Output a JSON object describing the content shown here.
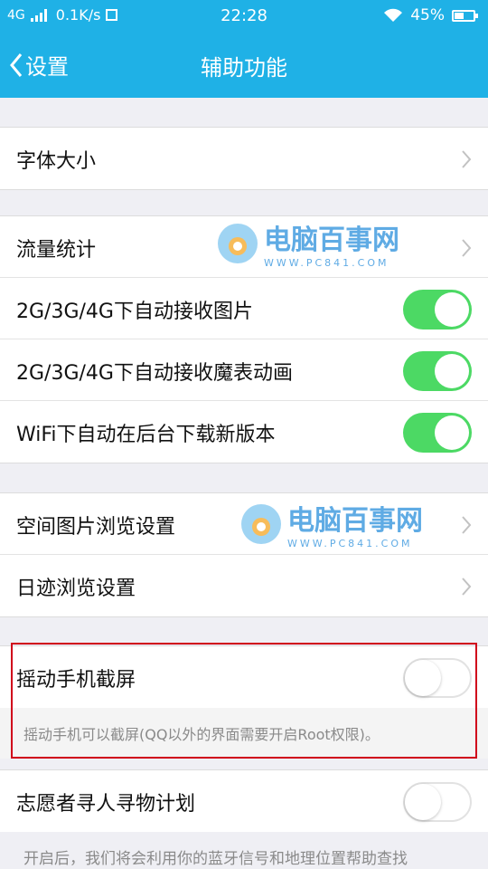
{
  "status": {
    "network": "4G",
    "speed": "0.1K/s",
    "time": "22:28",
    "battery": "45%",
    "battery_level": 0.45
  },
  "header": {
    "back_label": "设置",
    "title": "辅助功能"
  },
  "items": {
    "font_size": "字体大小",
    "traffic_stats": "流量统计",
    "auto_receive_images": "2G/3G/4G下自动接收图片",
    "auto_receive_magic": "2G/3G/4G下自动接收魔表动画",
    "wifi_auto_download": "WiFi下自动在后台下载新版本",
    "space_image_settings": "空间图片浏览设置",
    "diary_settings": "日迹浏览设置",
    "shake_screenshot": "摇动手机截屏",
    "shake_desc": "摇动手机可以截屏(QQ以外的界面需要开启Root权限)。",
    "volunteer": "志愿者寻人寻物计划",
    "volunteer_desc": "开启后，我们将会利用你的蓝牙信号和地理位置帮助查找"
  },
  "toggles": {
    "auto_receive_images": true,
    "auto_receive_magic": true,
    "wifi_auto_download": true,
    "shake_screenshot": false,
    "volunteer": false
  },
  "watermark": {
    "name": "电脑百事网",
    "url": "WWW.PC841.COM"
  },
  "colors": {
    "accent": "#1fb1e6",
    "toggle_on": "#4cd964",
    "highlight": "#d0021b"
  }
}
